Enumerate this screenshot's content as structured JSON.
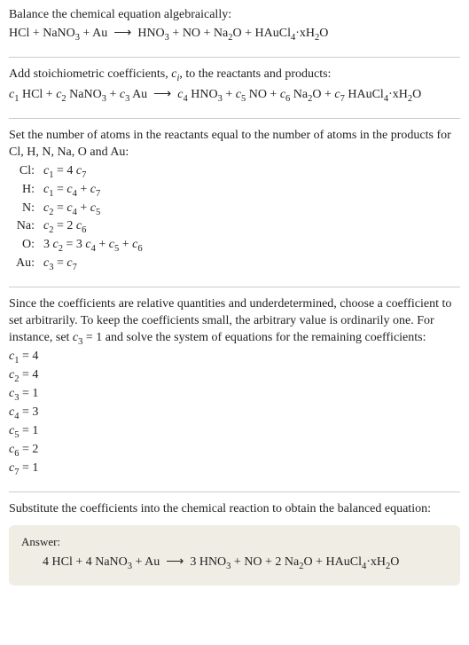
{
  "section1": {
    "intro": "Balance the chemical equation algebraically:",
    "equation": "HCl + NaNO<sub>3</sub> + Au &nbsp;⟶&nbsp; HNO<sub>3</sub> + NO + Na<sub>2</sub>O + HAuCl<sub>4</sub>·xH<sub>2</sub>O"
  },
  "section2": {
    "intro": "Add stoichiometric coefficients, <i>c<sub>i</sub></i>, to the reactants and products:",
    "equation": "<i>c</i><sub>1</sub> HCl + <i>c</i><sub>2</sub> NaNO<sub>3</sub> + <i>c</i><sub>3</sub> Au &nbsp;⟶&nbsp; <i>c</i><sub>4</sub> HNO<sub>3</sub> + <i>c</i><sub>5</sub> NO + <i>c</i><sub>6</sub> Na<sub>2</sub>O + <i>c</i><sub>7</sub> HAuCl<sub>4</sub>·xH<sub>2</sub>O"
  },
  "section3": {
    "intro": "Set the number of atoms in the reactants equal to the number of atoms in the products for Cl, H, N, Na, O and Au:",
    "rows": [
      {
        "el": "Cl:",
        "eq": "<i>c</i><sub>1</sub> = 4 <i>c</i><sub>7</sub>"
      },
      {
        "el": "H:",
        "eq": "<i>c</i><sub>1</sub> = <i>c</i><sub>4</sub> + <i>c</i><sub>7</sub>"
      },
      {
        "el": "N:",
        "eq": "<i>c</i><sub>2</sub> = <i>c</i><sub>4</sub> + <i>c</i><sub>5</sub>"
      },
      {
        "el": "Na:",
        "eq": "<i>c</i><sub>2</sub> = 2 <i>c</i><sub>6</sub>"
      },
      {
        "el": "O:",
        "eq": "3 <i>c</i><sub>2</sub> = 3 <i>c</i><sub>4</sub> + <i>c</i><sub>5</sub> + <i>c</i><sub>6</sub>"
      },
      {
        "el": "Au:",
        "eq": "<i>c</i><sub>3</sub> = <i>c</i><sub>7</sub>"
      }
    ]
  },
  "section4": {
    "intro": "Since the coefficients are relative quantities and underdetermined, choose a coefficient to set arbitrarily. To keep the coefficients small, the arbitrary value is ordinarily one. For instance, set <i>c</i><sub>3</sub> = 1 and solve the system of equations for the remaining coefficients:",
    "coeffs": [
      "<i>c</i><sub>1</sub> = 4",
      "<i>c</i><sub>2</sub> = 4",
      "<i>c</i><sub>3</sub> = 1",
      "<i>c</i><sub>4</sub> = 3",
      "<i>c</i><sub>5</sub> = 1",
      "<i>c</i><sub>6</sub> = 2",
      "<i>c</i><sub>7</sub> = 1"
    ]
  },
  "section5": {
    "intro": "Substitute the coefficients into the chemical reaction to obtain the balanced equation:",
    "answer_label": "Answer:",
    "answer_eq": "4 HCl + 4 NaNO<sub>3</sub> + Au &nbsp;⟶&nbsp; 3 HNO<sub>3</sub> + NO + 2 Na<sub>2</sub>O + HAuCl<sub>4</sub>·xH<sub>2</sub>O"
  }
}
